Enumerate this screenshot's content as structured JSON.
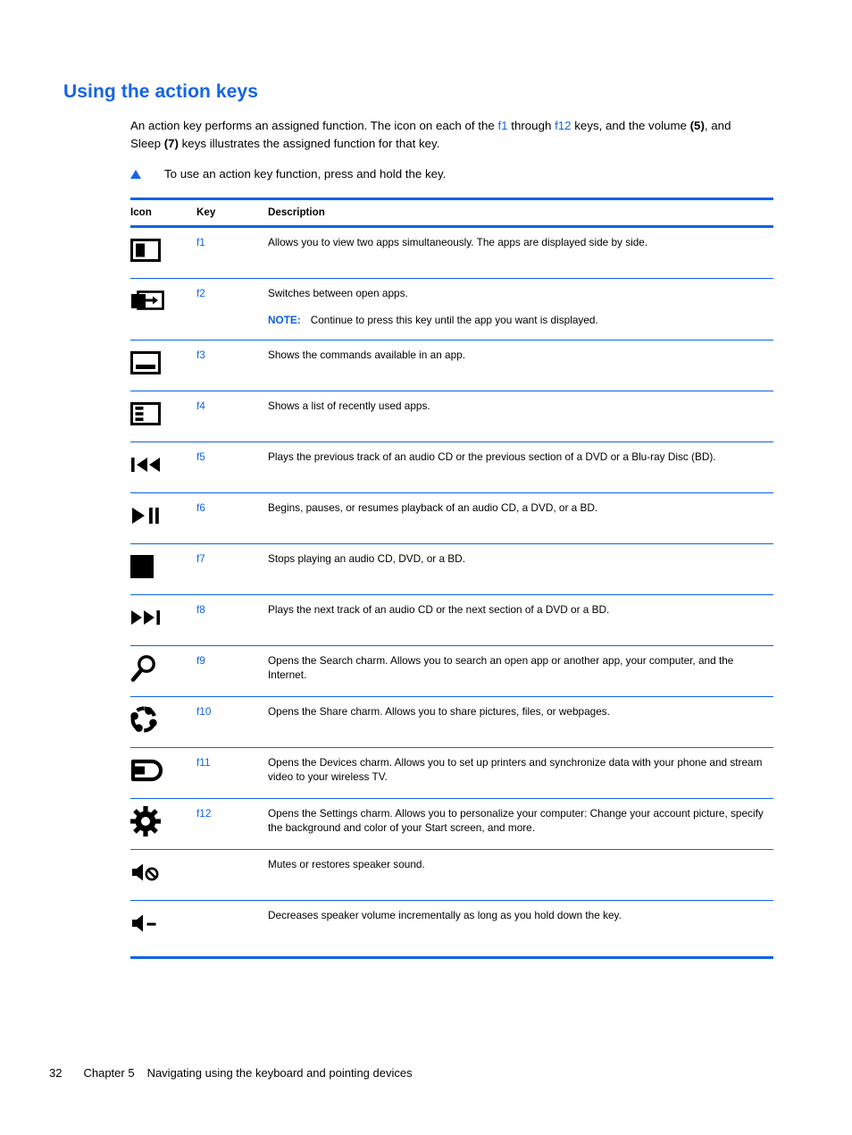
{
  "page": {
    "section_title": "Using the action keys",
    "intro_part1": "An action key performs an assigned function. The icon on each of the ",
    "intro_key_from": "f1",
    "intro_part2": " through ",
    "intro_key_to": "f12",
    "intro_part3": " keys, and the volume ",
    "intro_bold_5": "(5)",
    "intro_part4": ", and Sleep ",
    "intro_bold_7": "(7)",
    "intro_part5": " keys illustrates the assigned function for that key.",
    "bullet_text": "To use an action key function, press and hold the key."
  },
  "table": {
    "headers": {
      "icon": "Icon",
      "key": "Key",
      "description": "Description"
    },
    "rows": [
      {
        "icon_name": "split-screen-icon",
        "key": "f1",
        "description": "Allows you to view two apps simultaneously. The apps are displayed side by side.",
        "note_label": "",
        "note_text": ""
      },
      {
        "icon_name": "switch-apps-icon",
        "key": "f2",
        "description": "Switches between open apps.",
        "note_label": "NOTE:",
        "note_text": "Continue to press this key until the app you want is displayed."
      },
      {
        "icon_name": "app-commands-icon",
        "key": "f3",
        "description": "Shows the commands available in an app.",
        "note_label": "",
        "note_text": ""
      },
      {
        "icon_name": "recent-apps-icon",
        "key": "f4",
        "description": "Shows a list of recently used apps.",
        "note_label": "",
        "note_text": ""
      },
      {
        "icon_name": "previous-track-icon",
        "key": "f5",
        "description": "Plays the previous track of an audio CD or the previous section of a DVD or a Blu-ray Disc (BD).",
        "note_label": "",
        "note_text": ""
      },
      {
        "icon_name": "play-pause-icon",
        "key": "f6",
        "description": "Begins, pauses, or resumes playback of an audio CD, a DVD, or a BD.",
        "note_label": "",
        "note_text": ""
      },
      {
        "icon_name": "stop-icon",
        "key": "f7",
        "description": "Stops playing an audio CD, DVD, or a BD.",
        "note_label": "",
        "note_text": ""
      },
      {
        "icon_name": "next-track-icon",
        "key": "f8",
        "description": "Plays the next track of an audio CD or the next section of a DVD or a BD.",
        "note_label": "",
        "note_text": ""
      },
      {
        "icon_name": "search-icon",
        "key": "f9",
        "description": "Opens the Search charm. Allows you to search an open app or another app, your computer, and the Internet.",
        "note_label": "",
        "note_text": ""
      },
      {
        "icon_name": "share-icon",
        "key": "f10",
        "description": "Opens the Share charm. Allows you to share pictures, files, or webpages.",
        "note_label": "",
        "note_text": ""
      },
      {
        "icon_name": "devices-icon",
        "key": "f11",
        "description": "Opens the Devices charm. Allows you to set up printers and synchronize data with your phone and stream video to your wireless TV.",
        "note_label": "",
        "note_text": ""
      },
      {
        "icon_name": "settings-gear-icon",
        "key": "f12",
        "description": "Opens the Settings charm. Allows you to personalize your computer: Change your account picture, specify the background and color of your Start screen, and more.",
        "note_label": "",
        "note_text": ""
      },
      {
        "icon_name": "mute-speaker-icon",
        "key": "",
        "description": "Mutes or restores speaker sound.",
        "note_label": "",
        "note_text": ""
      },
      {
        "icon_name": "volume-down-icon",
        "key": "",
        "description": "Decreases speaker volume incrementally as long as you hold down the key.",
        "note_label": "",
        "note_text": ""
      }
    ]
  },
  "footer": {
    "page_number": "32",
    "chapter": "Chapter 5",
    "chapter_title": "Navigating using the keyboard and pointing devices"
  },
  "colors": {
    "accent_blue": "#1464E6",
    "rule_blue": "#0B64E6",
    "text_black": "#000000"
  }
}
